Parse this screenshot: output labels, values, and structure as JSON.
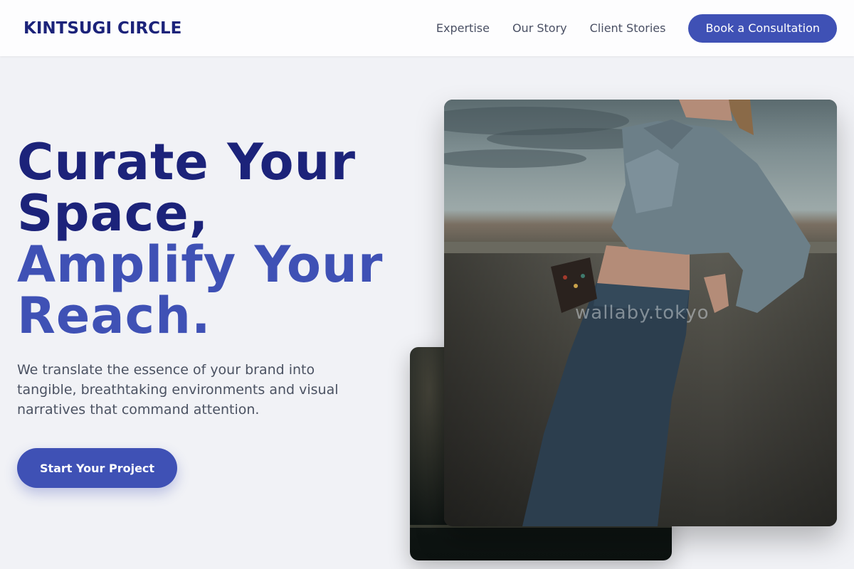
{
  "header": {
    "brand": "KINTSUGI CIRCLE",
    "nav": [
      "Expertise",
      "Our Story",
      "Client Stories"
    ],
    "cta_label": "Book a Consultation"
  },
  "hero": {
    "title_line1": "Curate Your",
    "title_line2": "Space,",
    "title_line3": "Amplify Your",
    "title_line4": "Reach.",
    "subtitle": "We translate the essence of your brand into tangible, breathtaking environments and visual narratives that command attention.",
    "button_label": "Start Your Project"
  },
  "images": {
    "watermark": "wallaby.tokyo"
  },
  "colors": {
    "accent": "#3f51b5",
    "brand_dark": "#1c237a",
    "background": "#f1f2f6"
  }
}
